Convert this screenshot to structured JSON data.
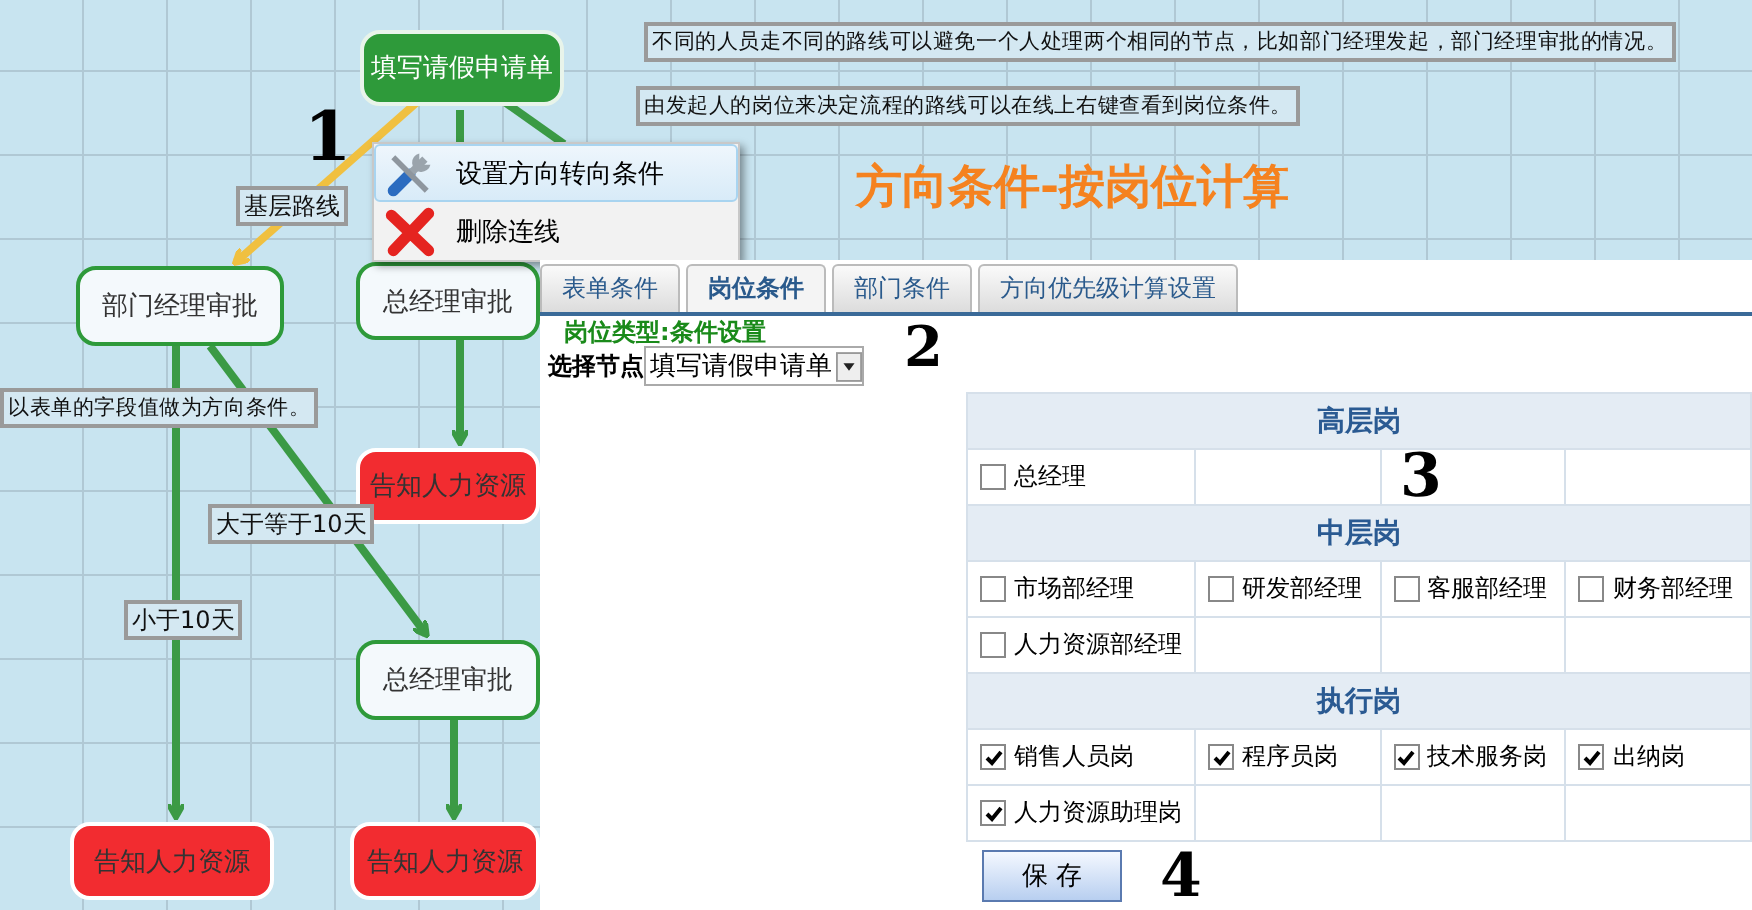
{
  "canvas": {
    "nodes": [
      {
        "label": "填写请假申请单",
        "kind": "start"
      },
      {
        "label": "部门经理审批",
        "kind": "task"
      },
      {
        "label": "总经理审批",
        "kind": "task"
      },
      {
        "label": "告知人力资源",
        "kind": "notify"
      },
      {
        "label": "总经理审批",
        "kind": "task"
      },
      {
        "label": "告知人力资源",
        "kind": "notify"
      },
      {
        "label": "告知人力资源",
        "kind": "notify"
      }
    ],
    "edge_labels": [
      "基层路线",
      "大于等于10天",
      "小于10天"
    ],
    "notes": [
      "不同的人员走不同的路线可以避免一个人处理两个相同的节点，比如部门经理发起，部门经理审批的情况。",
      "由发起人的岗位来决定流程的路线可以在线上右键查看到岗位条件。",
      "以表单的字段值做为方向条件。"
    ],
    "title": "方向条件-按岗位计算"
  },
  "context_menu": [
    {
      "label": "设置方向转向条件",
      "kind": "wrench",
      "selected": true
    },
    {
      "label": "删除连线",
      "kind": "delete",
      "selected": false
    }
  ],
  "panel": {
    "tabs": [
      {
        "label": "表单条件",
        "selected": false
      },
      {
        "label": "岗位条件",
        "selected": true
      },
      {
        "label": "部门条件",
        "selected": false
      },
      {
        "label": "方向优先级计算设置",
        "selected": false
      }
    ],
    "section_title": "岗位类型:条件设置",
    "node_select": {
      "label": "选择节点",
      "value": "填写请假申请单"
    },
    "groups": [
      {
        "title": "高层岗",
        "items": [
          {
            "label": "总经理",
            "checked": false
          }
        ]
      },
      {
        "title": "中层岗",
        "items": [
          {
            "label": "市场部经理",
            "checked": false
          },
          {
            "label": "研发部经理",
            "checked": false
          },
          {
            "label": "客服部经理",
            "checked": false
          },
          {
            "label": "财务部经理",
            "checked": false
          },
          {
            "label": "人力资源部经理",
            "checked": false
          }
        ]
      },
      {
        "title": "执行岗",
        "items": [
          {
            "label": "销售人员岗",
            "checked": true
          },
          {
            "label": "程序员岗",
            "checked": true
          },
          {
            "label": "技术服务岗",
            "checked": true
          },
          {
            "label": "出纳岗",
            "checked": true
          },
          {
            "label": "人力资源助理岗",
            "checked": true
          }
        ]
      }
    ],
    "save_button": "保 存"
  },
  "annotations": [
    "1",
    "2",
    "3",
    "4"
  ]
}
